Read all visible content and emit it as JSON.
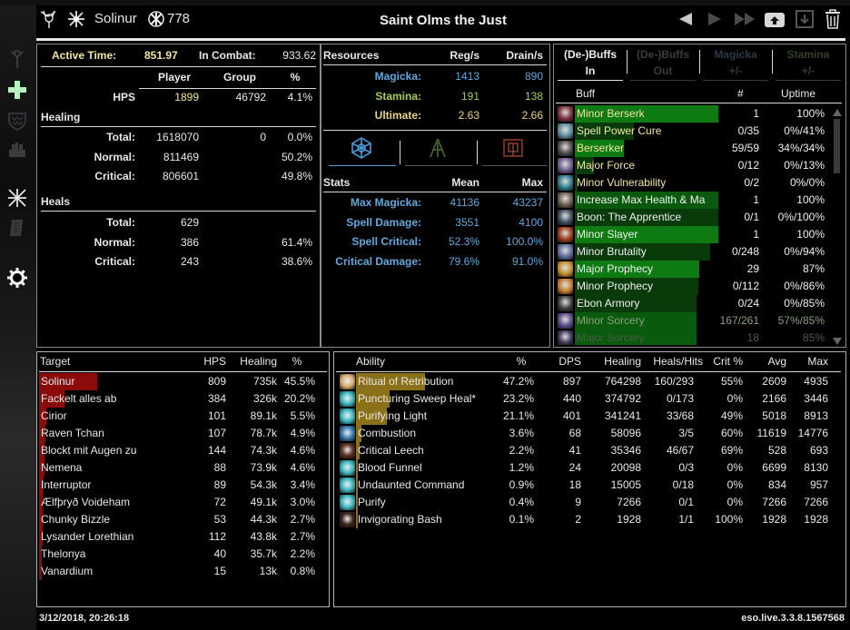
{
  "header": {
    "player_name": "Solinur",
    "champion_points": "778",
    "title": "Saint Olms the Just",
    "icons": [
      "alliance-icon",
      "class-icon",
      "champion-icon"
    ],
    "controls": [
      "previous-fight-button",
      "next-fight-button",
      "last-fight-button",
      "upload-button",
      "save-button",
      "delete-button"
    ]
  },
  "sidebar": {
    "items": [
      {
        "name": "damage-out",
        "icon": "damage-icon",
        "active": false
      },
      {
        "name": "healing-out",
        "icon": "healing-cross-icon",
        "active": true
      },
      {
        "name": "damage-in",
        "icon": "shield-icon",
        "active": false
      },
      {
        "name": "healing-in",
        "icon": "group-icon",
        "active": false
      },
      {
        "name": "combat-stats",
        "icon": "crossed-swords-icon",
        "active": false
      },
      {
        "name": "combat-log",
        "icon": "scroll-icon",
        "active": false
      },
      {
        "name": "settings",
        "icon": "gear-icon",
        "active": false
      }
    ]
  },
  "summary": {
    "active_time_label": "Active Time:",
    "active_time": "851.97",
    "in_combat_label": "In Combat:",
    "in_combat": "933.62",
    "col_player": "Player",
    "col_group": "Group",
    "col_pct": "%",
    "hps_label": "HPS",
    "hps_player": "1899",
    "hps_group": "46792",
    "hps_pct": "4.1%",
    "healing_header": "Healing",
    "healing_rows": [
      {
        "label": "Total:",
        "player": "1618070",
        "group": "0",
        "pct": "0.0%"
      },
      {
        "label": "Normal:",
        "player": "811469",
        "group": "",
        "pct": "50.2%"
      },
      {
        "label": "Critical:",
        "player": "806601",
        "group": "",
        "pct": "49.8%"
      }
    ],
    "heals_header": "Heals",
    "heals_rows": [
      {
        "label": "Total:",
        "player": "629",
        "pct": ""
      },
      {
        "label": "Normal:",
        "player": "386",
        "pct": "61.4%"
      },
      {
        "label": "Critical:",
        "player": "243",
        "pct": "38.6%"
      }
    ]
  },
  "resources": {
    "header": "Resources",
    "col_reg": "Reg/s",
    "col_drain": "Drain/s",
    "rows": [
      {
        "label": "Magicka:",
        "reg": "1413",
        "drain": "890",
        "color": "#61a9dc"
      },
      {
        "label": "Stamina:",
        "reg": "191",
        "drain": "138",
        "color": "#a7cf52"
      },
      {
        "label": "Ultimate:",
        "reg": "2.63",
        "drain": "2.66",
        "color": "#e8d583"
      }
    ],
    "tabs": [
      {
        "name": "magicka-tab",
        "icon": "magicka-icon",
        "active": true
      },
      {
        "name": "stamina-tab",
        "icon": "stamina-icon",
        "active": false
      },
      {
        "name": "health-tab",
        "icon": "health-icon",
        "active": false
      }
    ]
  },
  "stats": {
    "header": "Stats",
    "col_mean": "Mean",
    "col_max": "Max",
    "rows": [
      {
        "label": "Max Magicka:",
        "mean": "41136",
        "max": "43237"
      },
      {
        "label": "Spell Damage:",
        "mean": "3551",
        "max": "4100"
      },
      {
        "label": "Spell Critical:",
        "mean": "52.3%",
        "max": "100.0%"
      },
      {
        "label": "Critical Damage:",
        "mean": "79.6%",
        "max": "91.0%"
      }
    ]
  },
  "buffs": {
    "tabs": [
      {
        "line1": "(De-)Buffs",
        "line2": "In",
        "active": true
      },
      {
        "line1": "(De-)Buffs",
        "line2": "Out",
        "active": false
      },
      {
        "line1": "Magicka",
        "line2": "+/-",
        "active": false
      },
      {
        "line1": "Stamina",
        "line2": "+/-",
        "active": false
      }
    ],
    "col_buff": "Buff",
    "col_count": "#",
    "col_uptime": "Uptime",
    "rows": [
      {
        "name": "Minor Berserk",
        "count": "1",
        "uptime": "100%",
        "uptime_frac": 1.0,
        "bar": "bright",
        "text": "gold",
        "icon": "#7a2c3a"
      },
      {
        "name": "Spell Power Cure",
        "count": "0/35",
        "uptime": "0%/41%",
        "uptime_frac": 0.41,
        "bar": "dark",
        "text": "gold",
        "icon": "#5a8a9a"
      },
      {
        "name": "Berserker",
        "count": "59/59",
        "uptime": "34%/34%",
        "uptime_frac": 0.34,
        "bar": "bright",
        "text": "gold",
        "icon": "#4a4a4a"
      },
      {
        "name": "Major Force",
        "count": "0/12",
        "uptime": "0%/13%",
        "uptime_frac": 0.13,
        "bar": "dark",
        "text": "gold",
        "icon": "#6a5a8a"
      },
      {
        "name": "Minor Vulnerability",
        "count": "0/2",
        "uptime": "0%/0%",
        "uptime_frac": 0.0,
        "bar": "dark",
        "text": "gold",
        "icon": "#2a7a8a"
      },
      {
        "name": "Increase Max Health & Ma",
        "count": "1",
        "uptime": "100%",
        "uptime_frac": 1.0,
        "bar": "mid",
        "text": "white",
        "icon": "#6a5a4a"
      },
      {
        "name": "Boon: The Apprentice",
        "count": "0/1",
        "uptime": "0%/100%",
        "uptime_frac": 1.0,
        "bar": "dark",
        "text": "white",
        "icon": "#3a4a5a"
      },
      {
        "name": "Minor Slayer",
        "count": "1",
        "uptime": "100%",
        "uptime_frac": 1.0,
        "bar": "bright",
        "text": "white",
        "icon": "#9a3a1a"
      },
      {
        "name": "Minor Brutality",
        "count": "0/248",
        "uptime": "0%/94%",
        "uptime_frac": 0.94,
        "bar": "dark",
        "text": "white",
        "icon": "#5a6a9a"
      },
      {
        "name": "Major Prophecy",
        "count": "29",
        "uptime": "87%",
        "uptime_frac": 0.87,
        "bar": "bright",
        "text": "white",
        "icon": "#c08a2a"
      },
      {
        "name": "Minor Prophecy",
        "count": "0/112",
        "uptime": "0%/86%",
        "uptime_frac": 0.86,
        "bar": "dark",
        "text": "white",
        "icon": "#c07a2a"
      },
      {
        "name": "Ebon Armory",
        "count": "0/24",
        "uptime": "0%/85%",
        "uptime_frac": 0.85,
        "bar": "dark",
        "text": "white",
        "icon": "#3a3a3a"
      },
      {
        "name": "Minor Sorcery",
        "count": "167/261",
        "uptime": "57%/85%",
        "uptime_frac": 0.85,
        "bar": "mid",
        "text": "faded",
        "icon": "#5a4a8a"
      },
      {
        "name": "Major Sorcery",
        "count": "18",
        "uptime": "85%",
        "uptime_frac": 0.85,
        "bar": "mid",
        "text": "faded2",
        "icon": "#3a3050"
      }
    ]
  },
  "targets": {
    "col_target": "Target",
    "col_hps": "HPS",
    "col_healing": "Healing",
    "col_pct": "%",
    "rows": [
      {
        "name": "Solinur",
        "hps": "809",
        "healing": "735k",
        "pct": "45.5%",
        "frac": 0.455
      },
      {
        "name": "Fackelt alles ab",
        "hps": "384",
        "healing": "326k",
        "pct": "20.2%",
        "frac": 0.202
      },
      {
        "name": "Cirior",
        "hps": "101",
        "healing": "89.1k",
        "pct": "5.5%",
        "frac": 0.055
      },
      {
        "name": "Raven Tchan",
        "hps": "107",
        "healing": "78.7k",
        "pct": "4.9%",
        "frac": 0.049
      },
      {
        "name": "Blockt mit Augen zu",
        "hps": "144",
        "healing": "74.3k",
        "pct": "4.6%",
        "frac": 0.046
      },
      {
        "name": "Nemena",
        "hps": "88",
        "healing": "73.9k",
        "pct": "4.6%",
        "frac": 0.046
      },
      {
        "name": "Interruptor",
        "hps": "89",
        "healing": "54.3k",
        "pct": "3.4%",
        "frac": 0.034
      },
      {
        "name": "Ælfþryð Voideham",
        "hps": "72",
        "healing": "49.1k",
        "pct": "3.0%",
        "frac": 0.03
      },
      {
        "name": "Chunky Bizzle",
        "hps": "53",
        "healing": "44.3k",
        "pct": "2.7%",
        "frac": 0.027
      },
      {
        "name": "Lysander Lorethian",
        "hps": "112",
        "healing": "43.8k",
        "pct": "2.7%",
        "frac": 0.027
      },
      {
        "name": "Thelonya",
        "hps": "40",
        "healing": "35.7k",
        "pct": "2.2%",
        "frac": 0.022
      },
      {
        "name": "Vanardium",
        "hps": "15",
        "healing": "13k",
        "pct": "0.8%",
        "frac": 0.008
      }
    ]
  },
  "abilities": {
    "col_ability": "Ability",
    "col_pct": "%",
    "col_dps": "DPS",
    "col_healing": "Healing",
    "col_hits": "Heals/Hits",
    "col_crit": "Crit %",
    "col_avg": "Avg",
    "col_max": "Max",
    "rows": [
      {
        "name": "Ritual of Retribution",
        "pct": "47.2%",
        "dps": "897",
        "healing": "764298",
        "hits": "160/293",
        "crit": "55%",
        "avg": "2609",
        "max": "4935",
        "frac": 0.472,
        "icon": "#d9b070"
      },
      {
        "name": "Puncturing Sweep Heal*",
        "pct": "23.2%",
        "dps": "440",
        "healing": "374792",
        "hits": "0/173",
        "crit": "0%",
        "avg": "2166",
        "max": "3446",
        "frac": 0.232,
        "icon": "#3fb8c0"
      },
      {
        "name": "Purifying Light",
        "pct": "21.1%",
        "dps": "401",
        "healing": "341241",
        "hits": "33/68",
        "crit": "49%",
        "avg": "5018",
        "max": "8913",
        "frac": 0.211,
        "icon": "#3fb8c0"
      },
      {
        "name": "Combustion",
        "pct": "3.6%",
        "dps": "68",
        "healing": "58096",
        "hits": "3/5",
        "crit": "60%",
        "avg": "11619",
        "max": "14776",
        "frac": 0.036,
        "icon": "#3a7ab0"
      },
      {
        "name": "Critical Leech",
        "pct": "2.2%",
        "dps": "41",
        "healing": "35346",
        "hits": "46/67",
        "crit": "69%",
        "avg": "528",
        "max": "693",
        "frac": 0.022,
        "icon": "#5a3020"
      },
      {
        "name": "Blood Funnel",
        "pct": "1.2%",
        "dps": "24",
        "healing": "20098",
        "hits": "0/3",
        "crit": "0%",
        "avg": "6699",
        "max": "8130",
        "frac": 0.012,
        "icon": "#3fb8c0"
      },
      {
        "name": "Undaunted Command",
        "pct": "0.9%",
        "dps": "18",
        "healing": "15005",
        "hits": "0/18",
        "crit": "0%",
        "avg": "834",
        "max": "957",
        "frac": 0.009,
        "icon": "#3fb8c0"
      },
      {
        "name": "Purify",
        "pct": "0.4%",
        "dps": "9",
        "healing": "7266",
        "hits": "0/1",
        "crit": "0%",
        "avg": "7266",
        "max": "7266",
        "frac": 0.004,
        "icon": "#3fb8c0"
      },
      {
        "name": "Invigorating Bash",
        "pct": "0.1%",
        "dps": "2",
        "healing": "1928",
        "hits": "1/1",
        "crit": "100%",
        "avg": "1928",
        "max": "1928",
        "frac": 0.001,
        "icon": "#3a2418"
      }
    ]
  },
  "footer": {
    "timestamp": "3/12/2018, 20:26:18",
    "version": "eso.live.3.3.8.1567568"
  },
  "colors": {
    "target_bar": "#8b0a0a",
    "ability_bar": "#8a7018",
    "buff_bar_bright": "#0d7a12",
    "buff_bar_mid": "#0a5a0e",
    "buff_bar_dark": "#083a0a",
    "gold_text": "#f2e6a0",
    "magicka": "#61a9dc",
    "stamina": "#a7cf52",
    "ultimate": "#e8d583"
  }
}
